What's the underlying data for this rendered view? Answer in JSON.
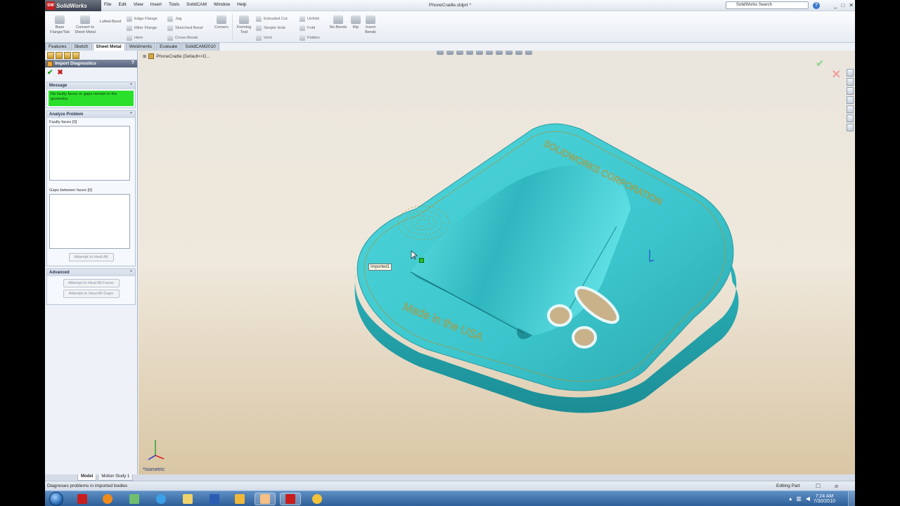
{
  "app": {
    "logo_text": "SolidWorks",
    "logo_badge": "SW",
    "document_title": "PhoneCradle.sldprt *",
    "search_placeholder": "SolidWorks Search",
    "help_label": "?",
    "window_controls": [
      "_",
      "□",
      "✕"
    ]
  },
  "menu": [
    "File",
    "Edit",
    "View",
    "Insert",
    "Tools",
    "SolidCAM",
    "Window",
    "Help"
  ],
  "command_manager": {
    "big_buttons": [
      {
        "label": "Base Flange/Tab"
      },
      {
        "label": "Convert to Sheet Metal"
      },
      {
        "label": "Lofted-Bend"
      },
      {
        "label": "Corners"
      },
      {
        "label": "Forming Tool"
      },
      {
        "label": "No Bends"
      },
      {
        "label": "Rip"
      },
      {
        "label": "Insert Bends"
      }
    ],
    "group1": [
      "Edge Flange",
      "Miter Flange",
      "Hem"
    ],
    "group2": [
      "Jog",
      "Sketched Bend",
      "Cross-Break"
    ],
    "group3": [
      "Extruded Cut",
      "Simple Hole",
      "Vent"
    ],
    "group4": [
      "Unfold",
      "Fold",
      "Flatten"
    ]
  },
  "tabs": [
    {
      "label": "Features",
      "active": false
    },
    {
      "label": "Sketch",
      "active": false
    },
    {
      "label": "Sheet Metal",
      "active": true
    },
    {
      "label": "Weldments",
      "active": false
    },
    {
      "label": "Evaluate",
      "active": false
    },
    {
      "label": "SolidCAM2010",
      "active": false
    }
  ],
  "property_manager": {
    "title": "Import Diagnostics",
    "help": "?",
    "ok_symbol": "✔",
    "cancel_symbol": "✖",
    "message_header": "Message",
    "message_text": "No faulty faces or gaps remain in the geometry.",
    "analyze_header": "Analyze Problem",
    "faulty_faces_label": "Faulty faces [0]",
    "gaps_label": "Gaps between faces [0]",
    "heal_all_button": "Attempt to Heal All",
    "advanced_header": "Advanced",
    "heal_faces_button": "Attempt to Heal All Faces",
    "heal_gaps_button": "Attempt to Heal All Gaps"
  },
  "graphics": {
    "tree_flyout": "PhoneCradle  (Default<<D...",
    "imported_tag": "Imported1",
    "view_orientation": "*Isometric",
    "model_text_top": "SOLIDWORKS CORPORATION",
    "model_text_bottom": "Made in the USA",
    "model_color": "#3ec9cf",
    "background_top": "#eae6dd",
    "background_bottom": "#d9c6a4"
  },
  "bottom_tabs": [
    {
      "label": "Model",
      "active": true
    },
    {
      "label": "Motion Study 1",
      "active": false
    }
  ],
  "status": {
    "hint": "Diagnoses problems in imported bodies",
    "mode": "Editing Part"
  },
  "taskbar": {
    "apps": [
      "start",
      "solidworks",
      "media-player",
      "network-app",
      "internet-explorer",
      "file-explorer",
      "word",
      "paint",
      "notepad",
      "solidworks-active",
      "flower-app"
    ],
    "time": "7:24 AM",
    "date": "7/30/2010"
  }
}
